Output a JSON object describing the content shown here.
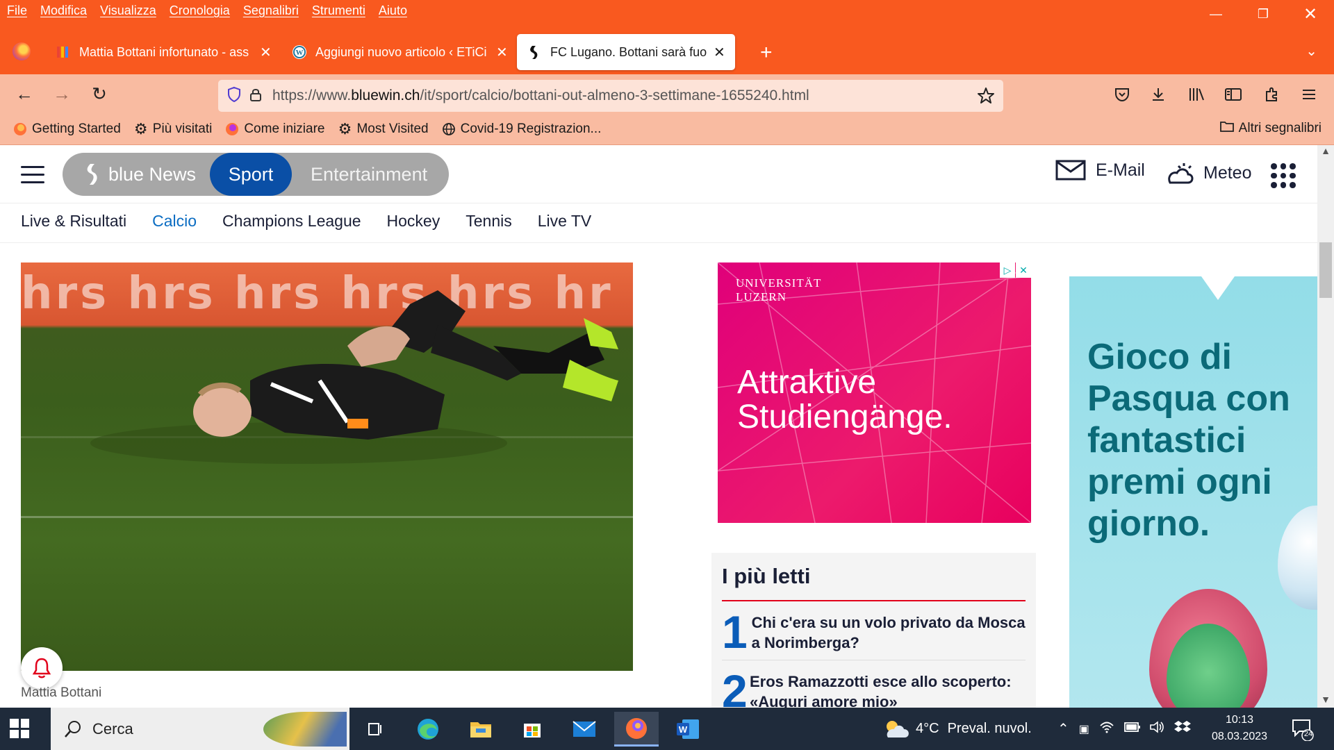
{
  "menubar": [
    "File",
    "Modifica",
    "Visualizza",
    "Cronologia",
    "Segnalibri",
    "Strumenti",
    "Aiuto"
  ],
  "tabs": [
    {
      "title": "Mattia Bottani infortunato - ass"
    },
    {
      "title": "Aggiungi nuovo articolo ‹ ETiCi"
    },
    {
      "title": "FC Lugano. Bottani sarà fuori al"
    }
  ],
  "urlbar": {
    "prefix": "https://www.",
    "domain": "bluewin.ch",
    "path": "/it/sport/calcio/bottani-out-almeno-3-settimane-1655240.html"
  },
  "bookmarks": [
    "Getting Started",
    "Più visitati",
    "Come iniziare",
    "Most Visited",
    "Covid-19 Registrazion..."
  ],
  "bookmarks_other": "Altri segnalibri",
  "site": {
    "brand": "blue News",
    "sections": [
      "Sport",
      "Entertainment"
    ],
    "email": "E-Mail",
    "meteo": "Meteo",
    "subnav": [
      "Live & Risultati",
      "Calcio",
      "Champions League",
      "Hockey",
      "Tennis",
      "Live TV"
    ],
    "hero_banner_text": "hrs  hrs  hrs  hrs  hrs  hr",
    "caption": "Mattia Bottani"
  },
  "ad1": {
    "org_line1": "UNIVERSITÄT",
    "org_line2": "LUZERN",
    "headline1": "Attraktive",
    "headline2": "Studiengänge."
  },
  "most_read": {
    "title": "I più letti",
    "items": [
      {
        "n": "1",
        "text": "Chi c'era su un volo privato da Mosca a Norimberga?"
      },
      {
        "n": "2",
        "text": "Eros Ramazzotti esce allo scoperto: «Auguri amore mio»"
      }
    ]
  },
  "ad2": {
    "line1": "Gioco di",
    "line2": "Pasqua con",
    "line3": "fantastici",
    "line4": "premi ogni",
    "line5": "giorno."
  },
  "taskbar": {
    "search": "Cerca",
    "weather": "4°C",
    "weather_text": "Preval. nuvol.",
    "time": "10:13",
    "date": "08.03.2023",
    "notifications": "24"
  },
  "colors": {
    "firefox_orange": "#f9591f",
    "toolbar_peach": "#f9bba1",
    "bluewin_blue": "#0a4fa6",
    "accent_red": "#e1001a"
  }
}
